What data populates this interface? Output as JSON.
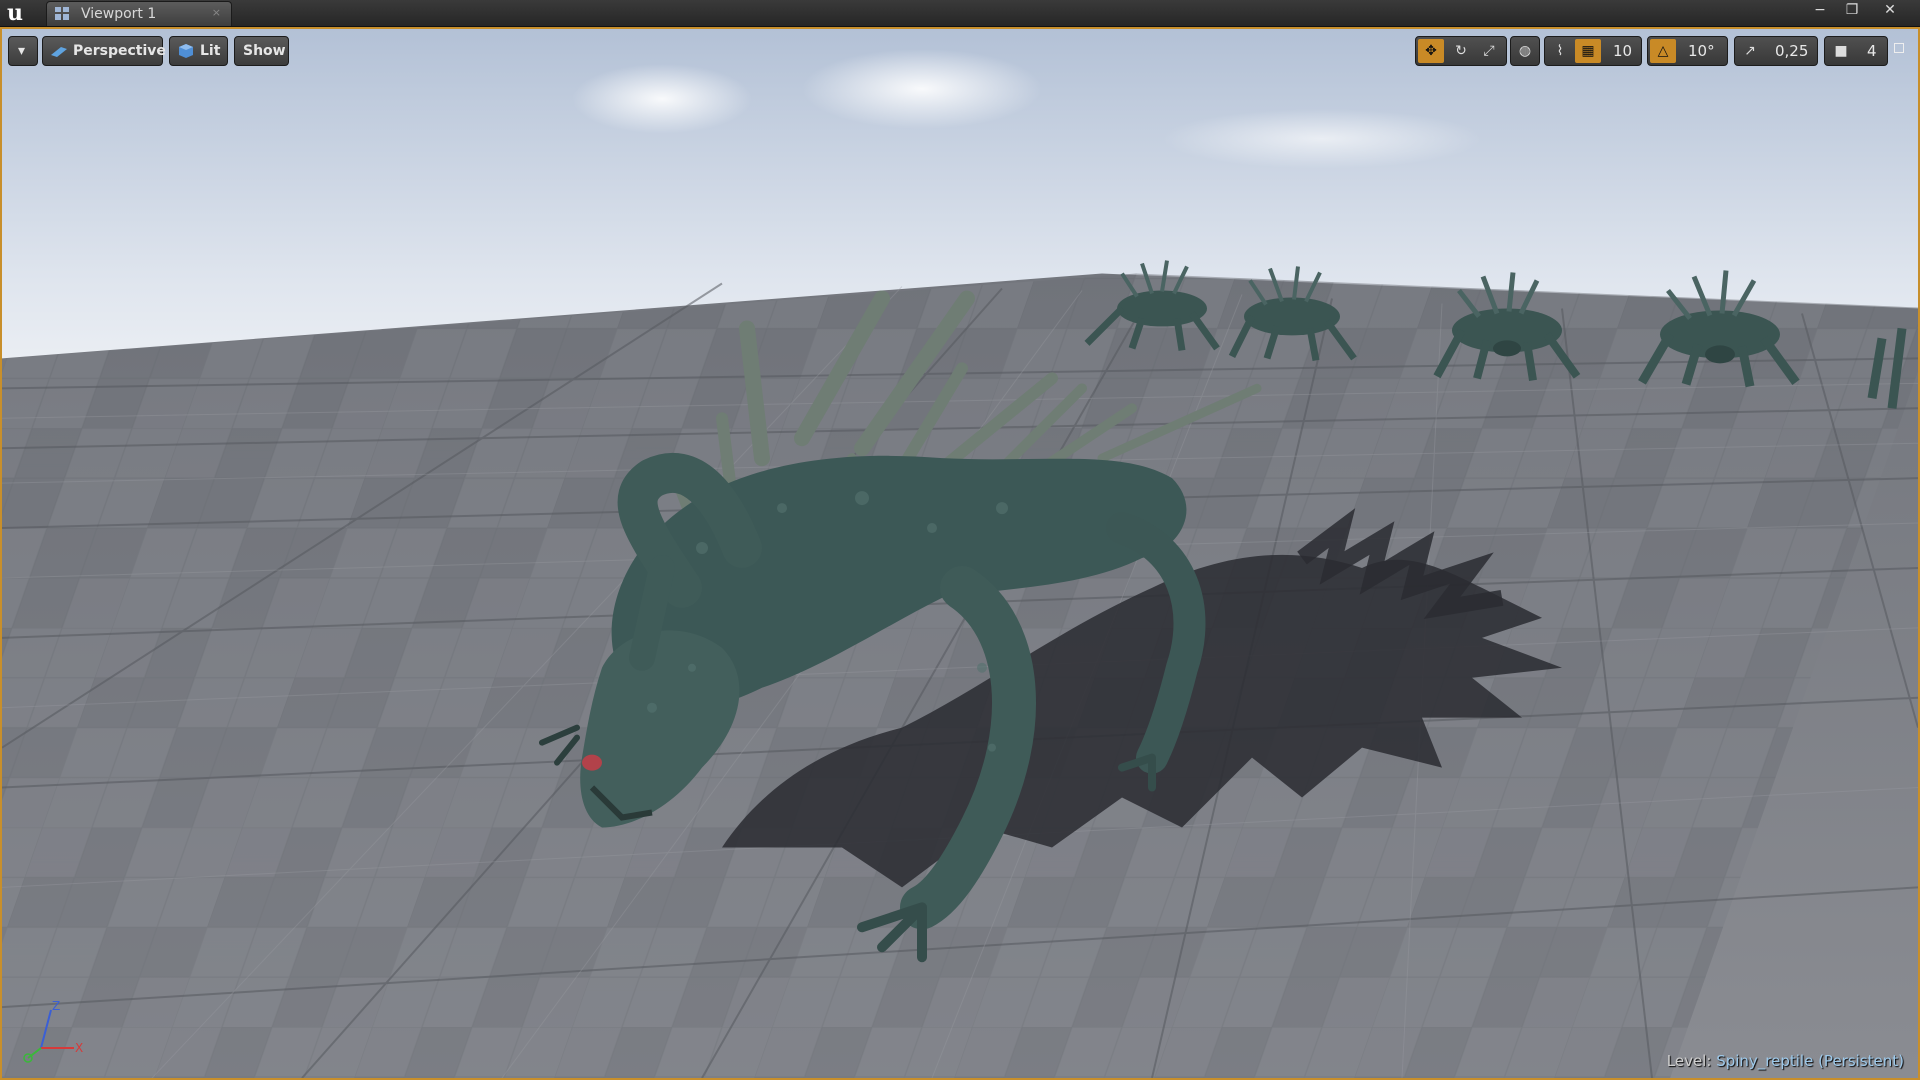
{
  "window": {
    "tab_title": "Viewport 1",
    "tab_close_glyph": "×",
    "buttons": [
      "minimize",
      "restore",
      "close"
    ],
    "minimize_glyph": "−",
    "restore_glyph": "❐",
    "close_glyph": "✕"
  },
  "toolbar": {
    "options_glyph": "▾",
    "perspective_label": "Perspective",
    "lit_label": "Lit",
    "show_label": "Show",
    "grid_snap_value": "10",
    "rotation_snap_value": "10°",
    "scale_snap_value": "0,25",
    "camera_speed_value": "4",
    "icons": [
      "translate-icon",
      "rotate-icon",
      "scale-icon",
      "world-space-icon",
      "surface-snap-icon",
      "grid-snap-icon",
      "rotation-snap-icon",
      "scale-snap-icon",
      "camera-speed-icon",
      "maximize-icon"
    ]
  },
  "status": {
    "level_prefix": "Level:",
    "level_name": "Spiny_reptile (Persistent)"
  },
  "scene": {
    "description_icon": "spiny-reptile-creature",
    "creature_count": 6
  },
  "colors": {
    "accent": "#c98a26",
    "viewport_border": "#c88f2b",
    "level_name": "#9ec9ea",
    "creature_skin": "#3d5a58",
    "floor_light": "#8e9097",
    "floor_dark": "#6d6f76",
    "sky_top": "#b9c6d8",
    "sky_horizon": "#e6ebf1"
  }
}
